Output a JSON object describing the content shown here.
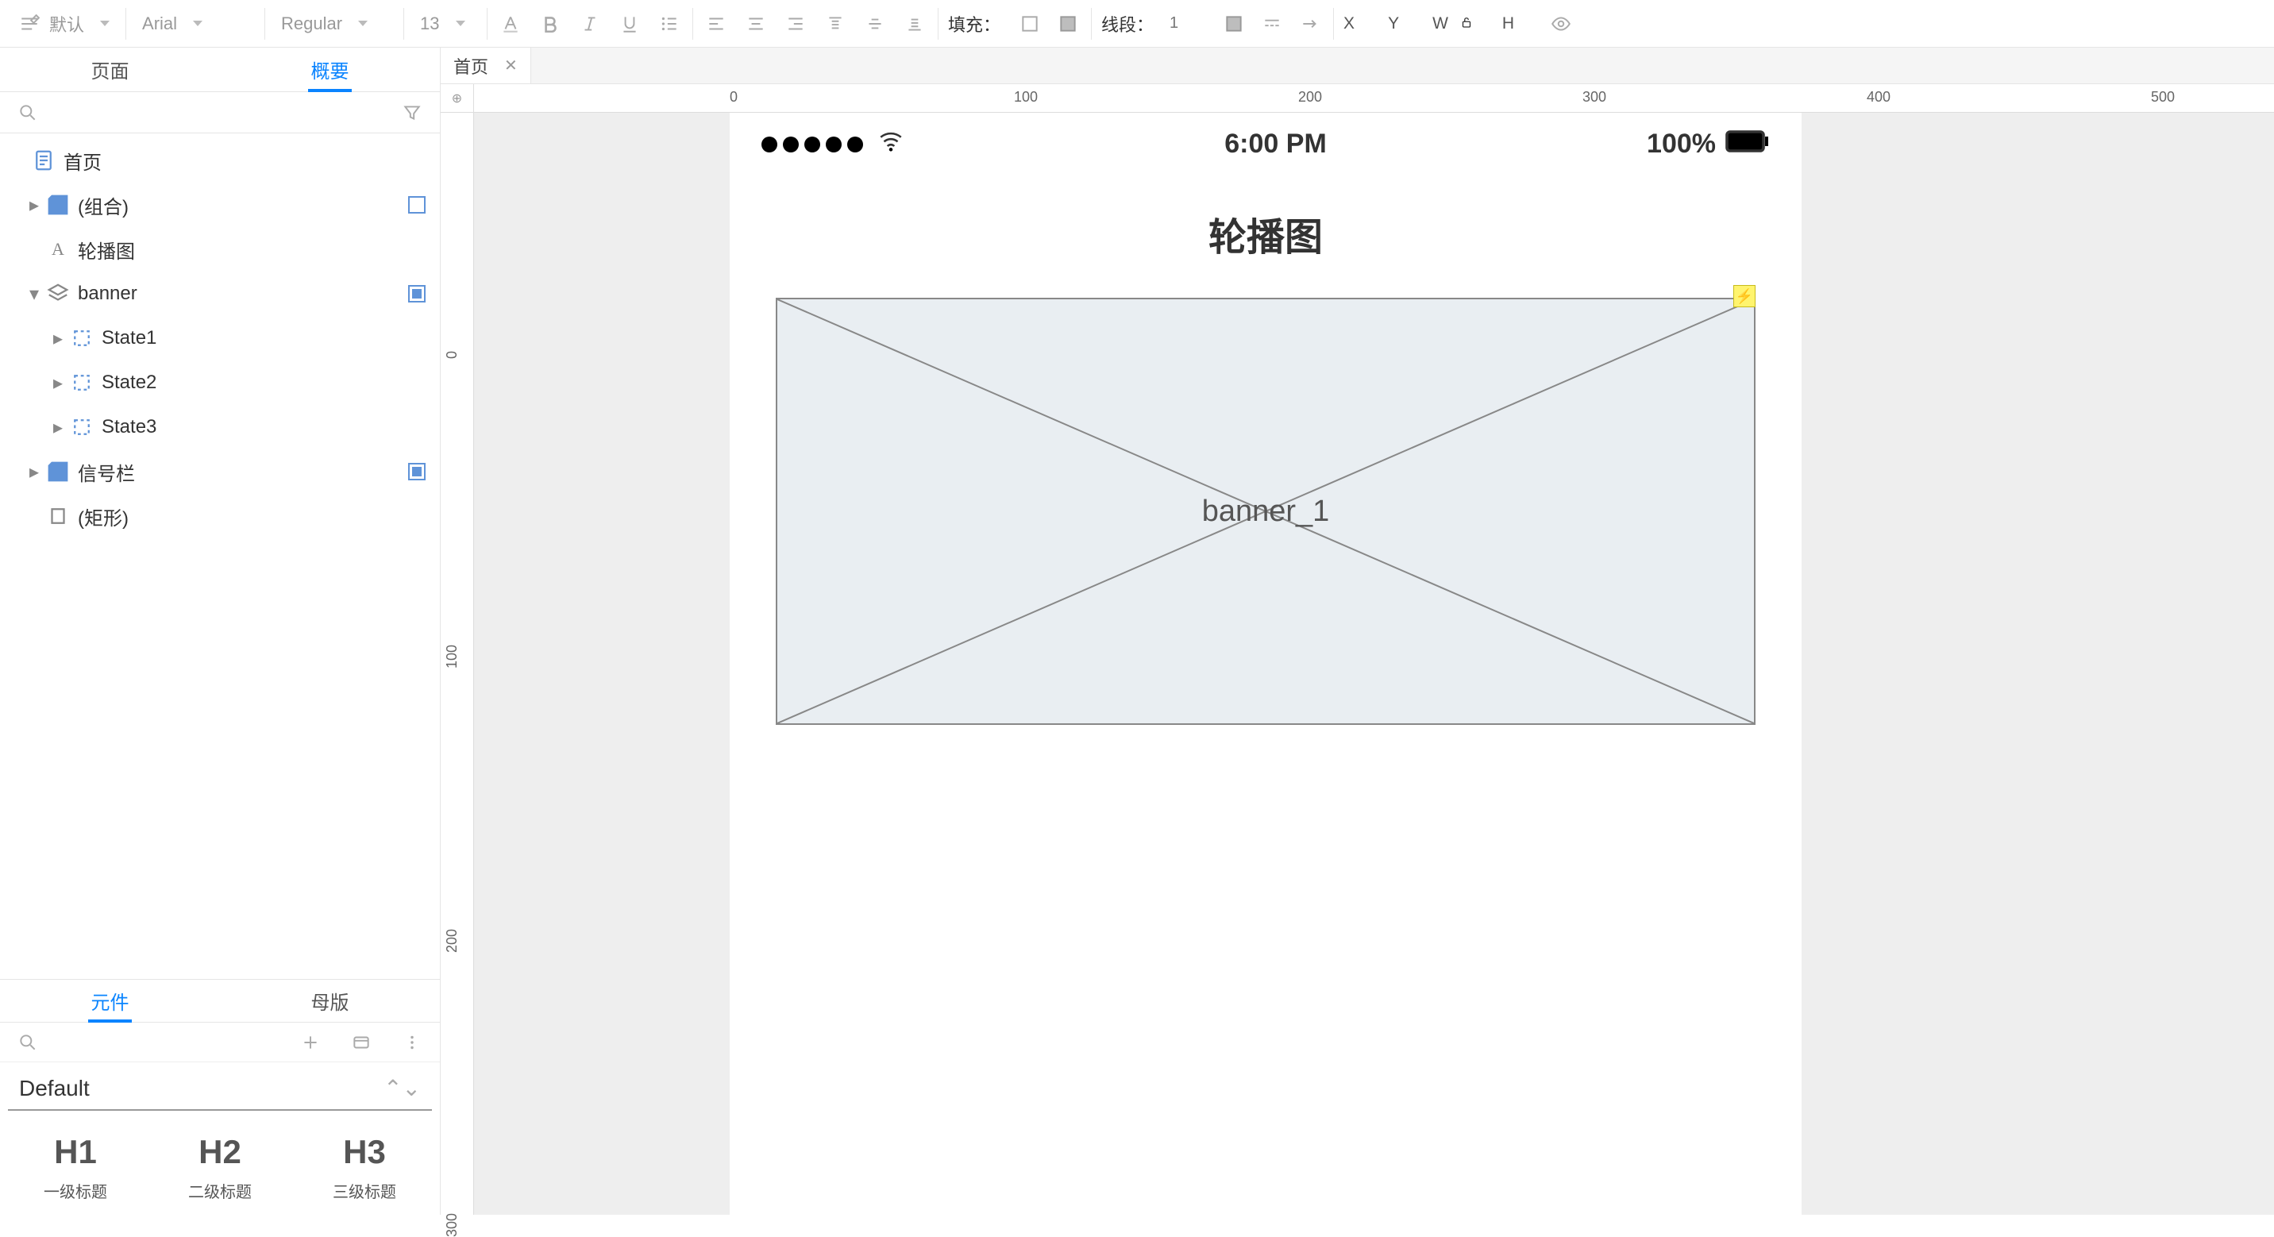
{
  "toolbar": {
    "style_preset": "默认",
    "font_family": "Arial",
    "font_weight": "Regular",
    "font_size": "13",
    "fill_label": "填充：",
    "line_label": "线段：",
    "line_width": "1",
    "x_label": "X",
    "y_label": "Y",
    "w_label": "W",
    "h_label": "H"
  },
  "left_tabs": {
    "pages": "页面",
    "outline": "概要"
  },
  "outline": {
    "page_name": "首页",
    "items": {
      "group": "(组合)",
      "carousel": "轮播图",
      "banner": "banner",
      "state1": "State1",
      "state2": "State2",
      "state3": "State3",
      "signal_bar": "信号栏",
      "rectangle": "(矩形)"
    }
  },
  "widgets_tabs": {
    "widgets": "元件",
    "masters": "母版"
  },
  "widgets": {
    "library": "Default",
    "h1": {
      "big": "H1",
      "small": "一级标题"
    },
    "h2": {
      "big": "H2",
      "small": "二级标题"
    },
    "h3": {
      "big": "H3",
      "small": "三级标题"
    }
  },
  "doc_tab": {
    "name": "首页"
  },
  "ruler": {
    "h_ticks": [
      "0",
      "100",
      "200",
      "300",
      "400",
      "500"
    ],
    "v_ticks": [
      "0",
      "100",
      "200",
      "300"
    ]
  },
  "canvas": {
    "status_time": "6:00 PM",
    "status_battery": "100%",
    "title": "轮播图",
    "banner_label": "banner_1"
  }
}
